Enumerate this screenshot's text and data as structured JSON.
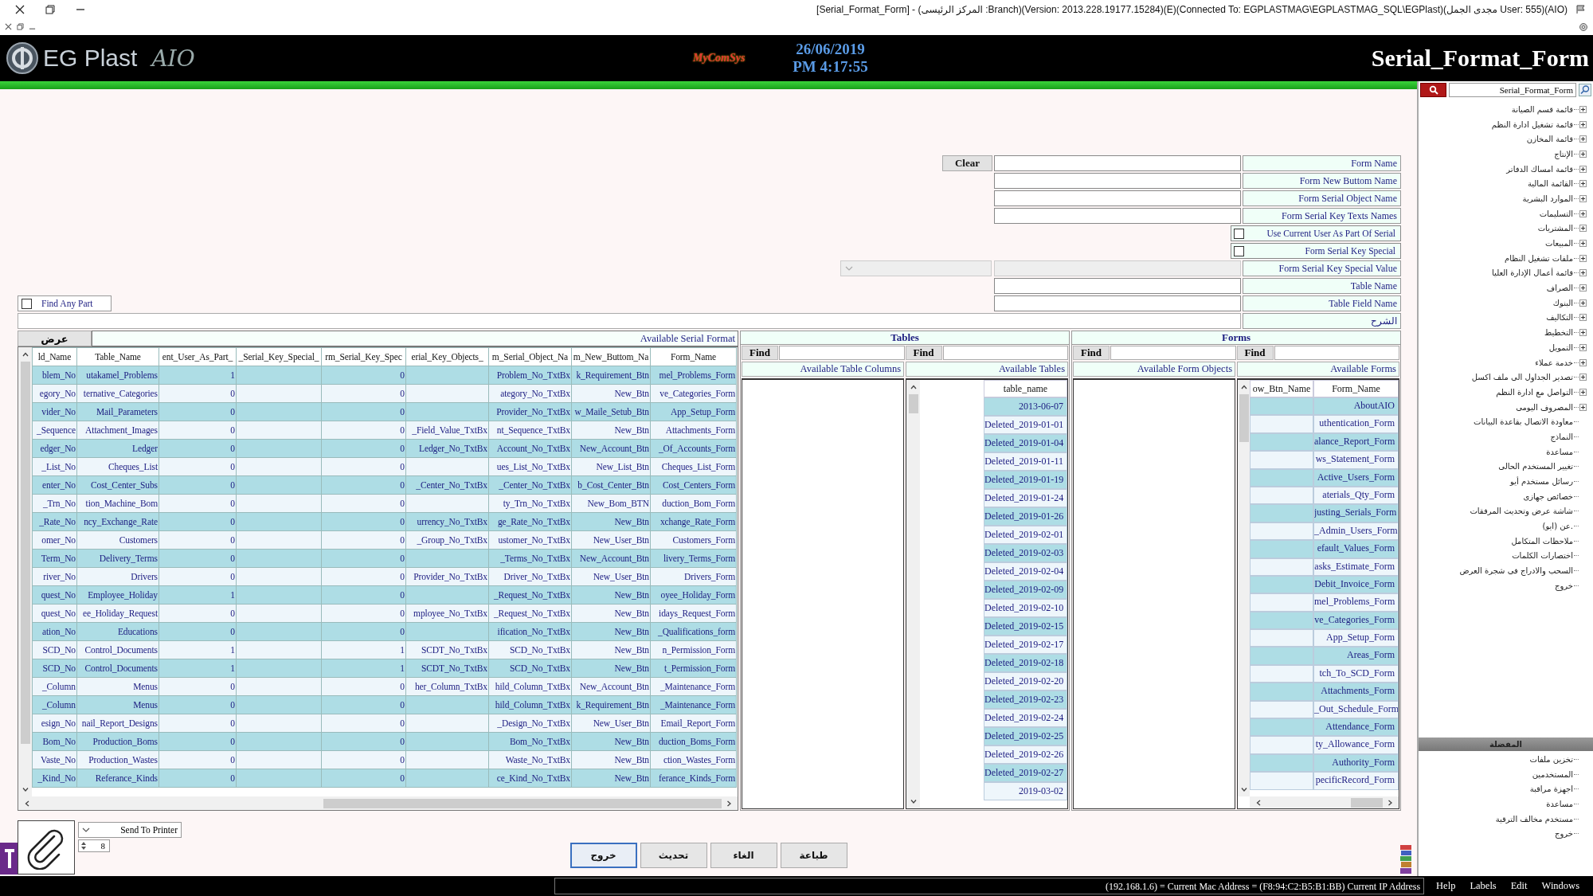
{
  "window": {
    "title": "[Serial_Format_Form] - (المركز الرئيسى :Branch)(Version: 2013.228.19177.15284)(E)(Connected To: EGPLASTMAG\\EGPLASTMAG_SQL\\EGPlast)(مجدى الجمل User: 555)(AIO)"
  },
  "header": {
    "app_name": "EG Plast",
    "app_badge": "AIO",
    "vendor": "MyComSys",
    "date": "26/06/2019",
    "time": "PM 4:17:55",
    "form_title": "Serial_Format_Form"
  },
  "form": {
    "fields": [
      {
        "kind": "text",
        "label": "Form Name",
        "button": "Clear"
      },
      {
        "kind": "text",
        "label": "Form New Buttom Name"
      },
      {
        "kind": "text",
        "label": "Form Serial Object Name"
      },
      {
        "kind": "text",
        "label": "Form Serial Key Texts Names"
      },
      {
        "kind": "checkbox",
        "label": "Use Current User As Part Of Serial",
        "checked": false
      },
      {
        "kind": "checkbox",
        "label": "Form Serial Key Special",
        "checked": false
      },
      {
        "kind": "select",
        "label": "Form Serial Key Special Value",
        "disabled": true
      },
      {
        "kind": "text",
        "label": "Table Name"
      },
      {
        "kind": "text",
        "label": "Table Field Name"
      },
      {
        "kind": "memo",
        "label": "الشرح"
      }
    ],
    "find_any_part": {
      "label": "Find Any Part",
      "checked": false
    }
  },
  "serial_grid": {
    "show_button": "عرض",
    "title": "Available Serial Format",
    "columns": [
      "ld_Name",
      "Table_Name",
      "ent_User_As_Part_",
      "_Serial_Key_Special_",
      "rm_Serial_Key_Spec",
      "erial_Key_Objects_",
      "m_Serial_Object_Na",
      "m_New_Buttom_Na",
      "Form_Name"
    ],
    "rows": [
      [
        "blem_No",
        "utakamel_Problems",
        "1",
        "",
        "0",
        "",
        "Problem_No_TxtBx",
        "k_Requirement_Btn",
        "mel_Problems_Form"
      ],
      [
        "egory_No",
        "ternative_Categories",
        "0",
        "",
        "0",
        "",
        "ategory_No_TxtBx",
        "New_Btn",
        "ve_Categories_Form"
      ],
      [
        "vider_No",
        "Mail_Parameters",
        "0",
        "",
        "0",
        "",
        "Provider_No_TxtBx",
        "w_Maile_Setub_Btn",
        "App_Setup_Form"
      ],
      [
        "_Sequence",
        "Attachment_Images",
        "0",
        "",
        "0",
        "_Field_Value_TxtBx",
        "nt_Sequence_TxtBx",
        "New_Btn",
        "Attachments_Form"
      ],
      [
        "edger_No",
        "Ledger",
        "0",
        "",
        "0",
        "Ledger_No_TxtBx",
        "Account_No_TxtBx",
        "New_Account_Btn",
        "_Of_Accounts_Form"
      ],
      [
        "_List_No",
        "Cheques_List",
        "0",
        "",
        "0",
        "",
        "ues_List_No_TxtBx",
        "New_List_Btn",
        "Cheques_List_Form"
      ],
      [
        "enter_No",
        "Cost_Center_Subs",
        "0",
        "",
        "0",
        "_Center_No_TxtBx",
        "_Center_No_TxtBx",
        "b_Cost_Center_Btn",
        "Cost_Centers_Form"
      ],
      [
        "_Trn_No",
        "tion_Machine_Bom",
        "0",
        "",
        "0",
        "",
        "ty_Trn_No_TxtBx",
        "New_Bom_BTN",
        "duction_Bom_Form"
      ],
      [
        "_Rate_No",
        "ncy_Exchange_Rate",
        "0",
        "",
        "0",
        "urrency_No_TxtBx",
        "ge_Rate_No_TxtBx",
        "New_Btn",
        "xchange_Rate_Form"
      ],
      [
        "omer_No",
        "Customers",
        "0",
        "",
        "0",
        "_Group_No_TxtBx",
        "ustomer_No_TxtBx",
        "New_User_Btn",
        "Customers_Form"
      ],
      [
        "Term_No",
        "Delivery_Terms",
        "0",
        "",
        "0",
        "",
        "_Terms_No_TxtBx",
        "New_Account_Btn",
        "livery_Terms_Form"
      ],
      [
        "river_No",
        "Drivers",
        "0",
        "",
        "0",
        "Provider_No_TxtBx",
        "Driver_No_TxtBx",
        "New_User_Btn",
        "Drivers_Form"
      ],
      [
        "quest_No",
        "Employee_Holiday",
        "1",
        "",
        "0",
        "",
        "_Request_No_TxtBx",
        "New_Btn",
        "oyee_Holiday_Form"
      ],
      [
        "quest_No",
        "ee_Holiday_Request",
        "0",
        "",
        "0",
        "mployee_No_TxtBx",
        "_Request_No_TxtBx",
        "New_Btn",
        "idays_Request_Form"
      ],
      [
        "ation_No",
        "Educations",
        "0",
        "",
        "0",
        "",
        "ification_No_TxtBx",
        "New_Btn",
        "_Qualifications_form"
      ],
      [
        "SCD_No",
        "Control_Documents",
        "1",
        "",
        "1",
        "SCDT_No_TxtBx",
        "SCD_No_TxtBx",
        "New_Btn",
        "n_Permission_Form"
      ],
      [
        "SCD_No",
        "Control_Documents",
        "1",
        "",
        "1",
        "SCDT_No_TxtBx",
        "SCD_No_TxtBx",
        "New_Btn",
        "t_Permission_Form"
      ],
      [
        "_Column",
        "Menus",
        "0",
        "",
        "0",
        "her_Column_TxtBx",
        "hild_Column_TxtBx",
        "New_Account_Btn",
        "_Maintenance_Form"
      ],
      [
        "_Column",
        "Menus",
        "0",
        "",
        "0",
        "",
        "hild_Column_TxtBx",
        "k_Requirement_Btn",
        "_Maintenance_Form"
      ],
      [
        "esign_No",
        "nail_Report_Designs",
        "0",
        "",
        "0",
        "",
        "_Design_No_TxtBx",
        "New_User_Btn",
        "Email_Report_Form"
      ],
      [
        "Bom_No",
        "Production_Boms",
        "0",
        "",
        "0",
        "",
        "Bom_No_TxtBx",
        "New_Btn",
        "duction_Boms_Form"
      ],
      [
        "Vaste_No",
        "Production_Wastes",
        "0",
        "",
        "0",
        "",
        "Waste_No_TxtBx",
        "New_Btn",
        "ction_Wastes_Form"
      ],
      [
        "_Kind_No",
        "Referance_Kinds",
        "0",
        "",
        "0",
        "",
        "ce_Kind_No_TxtBx",
        "New_Btn",
        "ferance_Kinds_Form"
      ]
    ]
  },
  "tables_panel": {
    "title": "Tables",
    "find_buttons": [
      "Find",
      "Find"
    ],
    "columns_label": "Available Table Columns",
    "list_label": "Available Tables",
    "list_column": "table_name",
    "items": [
      "2013-06-07",
      "Deleted_2019-01-01",
      "Deleted_2019-01-04",
      "Deleted_2019-01-11",
      "Deleted_2019-01-19",
      "Deleted_2019-01-24",
      "Deleted_2019-01-26",
      "Deleted_2019-02-01",
      "Deleted_2019-02-03",
      "Deleted_2019-02-04",
      "Deleted_2019-02-09",
      "Deleted_2019-02-10",
      "Deleted_2019-02-15",
      "Deleted_2019-02-17",
      "Deleted_2019-02-18",
      "Deleted_2019-02-20",
      "Deleted_2019-02-23",
      "Deleted_2019-02-24",
      "Deleted_2019-02-25",
      "Deleted_2019-02-26",
      "Deleted_2019-02-27",
      "2019-03-02"
    ]
  },
  "forms_panel": {
    "title": "Forms",
    "find_buttons": [
      "Find",
      "Find"
    ],
    "objects_label": "Available Form Objects",
    "list_label": "Available Forms",
    "list_columns": [
      "ow_Btn_Name",
      "Form_Name"
    ],
    "items": [
      "AboutAIO",
      "uthentication_Form",
      "alance_Report_Form",
      "ws_Statement_Form",
      "Active_Users_Form",
      "aterials_Qty_Form",
      "justing_Serials_Form",
      "_Admin_Users_Form",
      "efault_Values_Form",
      "asks_Estimate_Form",
      "Debit_Invoice_Form",
      "mel_Problems_Form",
      "ve_Categories_Form",
      "App_Setup_Form",
      "Areas_Form",
      "tch_To_SCD_Form",
      "Attachments_Form",
      "_Out_Schedule_Form",
      "Attendance_Form",
      "ty_Allowance_Form",
      "Authority_Form",
      "pecificRecord_Form"
    ]
  },
  "bottom": {
    "printer_select": "Send To Printer",
    "copies": "8",
    "buttons": [
      {
        "label": "طباعة",
        "selected": false
      },
      {
        "label": "الغاء",
        "selected": false
      },
      {
        "label": "تحديث",
        "selected": false
      },
      {
        "label": "خروج",
        "selected": true
      }
    ]
  },
  "sidebar": {
    "search_value": "Serial_Format_Form",
    "menu": [
      {
        "label": "قائمة قسم الصيانة",
        "expandable": true
      },
      {
        "label": "قائمة تشغيل ادارة النظم",
        "expandable": true
      },
      {
        "label": "قائمة المخازن",
        "expandable": true
      },
      {
        "label": "الإنتاج",
        "expandable": true
      },
      {
        "label": "قائمة امساك الدفاتر",
        "expandable": true
      },
      {
        "label": "القائمة المالية",
        "expandable": true
      },
      {
        "label": "الموارد البشرية",
        "expandable": true
      },
      {
        "label": "التسليمات",
        "expandable": true
      },
      {
        "label": "المشتريات",
        "expandable": true
      },
      {
        "label": "المبيعات",
        "expandable": true
      },
      {
        "label": "ملفات تشغيل النظام",
        "expandable": true
      },
      {
        "label": "قائمة أعمال الإدارة العليا",
        "expandable": true
      },
      {
        "label": "الصراف",
        "expandable": true
      },
      {
        "label": "البنوك",
        "expandable": true
      },
      {
        "label": "التكاليف",
        "expandable": true
      },
      {
        "label": "التخطيط",
        "expandable": true
      },
      {
        "label": "التمويل",
        "expandable": true
      },
      {
        "label": "خدمة عملاء",
        "expandable": true
      },
      {
        "label": "تصدير الجداول الى ملف اكسل",
        "expandable": true
      },
      {
        "label": "التواصل مع ادارة النظم",
        "expandable": true
      },
      {
        "label": "المصروف اليومى",
        "expandable": true
      },
      {
        "label": "معاودة الاتصال بقاعدة البيانات",
        "expandable": false
      },
      {
        "label": "النماذج",
        "expandable": false
      },
      {
        "label": "مساعدة",
        "expandable": false
      },
      {
        "label": "تغيير المستخدم الحالى",
        "expandable": false
      },
      {
        "label": "رسائل مستخدم أيو",
        "expandable": false
      },
      {
        "label": "خصائص جهازى",
        "expandable": false
      },
      {
        "label": "شاشة عرض وتحديث المرفقات",
        "expandable": false
      },
      {
        "label": "عن (ايو).",
        "expandable": false
      },
      {
        "label": "ملاحظات المتكامل",
        "expandable": false
      },
      {
        "label": "اختصارات الكلمات",
        "expandable": false
      },
      {
        "label": "السحب والادراج فى شجرة العرض",
        "expandable": false
      },
      {
        "label": "خروج",
        "expandable": false
      }
    ],
    "favorites_title": "المفضلة",
    "favorites": [
      "تخزين ملفات",
      "المستخدمين",
      "اجهزة مراقبة",
      "مساعدة",
      "مستخدم مخالف الترقية",
      "خروج"
    ]
  },
  "status_bar": {
    "text": "(192.168.1.6) = Current Mac Address = (F8:94:C2:B5:B1:BB) Current IP Address",
    "menus": [
      "Help",
      "Labels",
      "Edit",
      "Windows"
    ]
  }
}
